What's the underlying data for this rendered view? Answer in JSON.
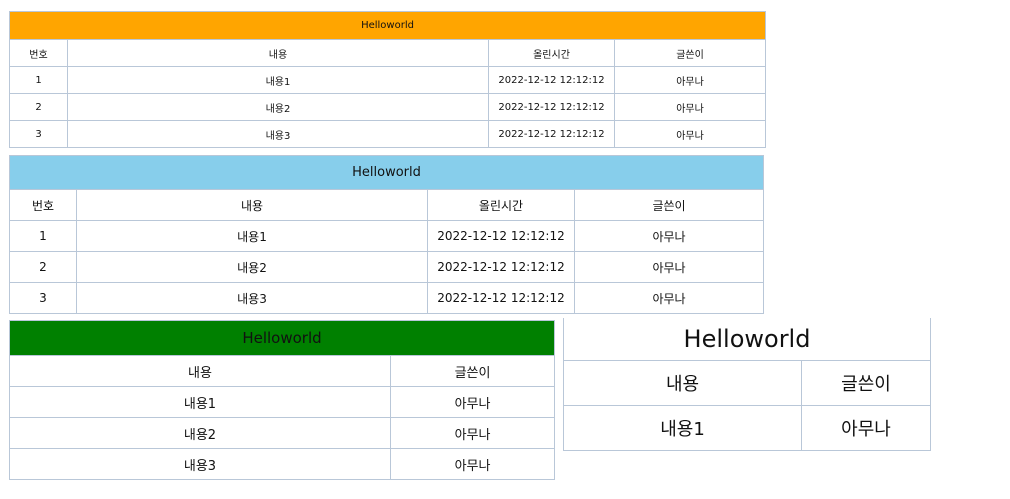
{
  "tables": [
    {
      "title": "Helloworld",
      "title_bg": "#FFA500",
      "headers": [
        "번호",
        "내용",
        "올린시간",
        "글쓴이"
      ],
      "rows": [
        [
          "1",
          "내용1",
          "2022-12-12 12:12:12",
          "아무나"
        ],
        [
          "2",
          "내용2",
          "2022-12-12 12:12:12",
          "아무나"
        ],
        [
          "3",
          "내용3",
          "2022-12-12 12:12:12",
          "아무나"
        ]
      ]
    },
    {
      "title": "Helloworld",
      "title_bg": "#87CEEB",
      "headers": [
        "번호",
        "내용",
        "올린시간",
        "글쓴이"
      ],
      "rows": [
        [
          "1",
          "내용1",
          "2022-12-12 12:12:12",
          "아무나"
        ],
        [
          "2",
          "내용2",
          "2022-12-12 12:12:12",
          "아무나"
        ],
        [
          "3",
          "내용3",
          "2022-12-12 12:12:12",
          "아무나"
        ]
      ]
    },
    {
      "title": "Helloworld",
      "title_bg": "#008000",
      "headers": [
        "내용",
        "글쓴이"
      ],
      "rows": [
        [
          "내용1",
          "아무나"
        ],
        [
          "내용2",
          "아무나"
        ],
        [
          "내용3",
          "아무나"
        ]
      ]
    },
    {
      "title": "Helloworld",
      "title_bg": "#FFFFFF",
      "headers": [
        "내용",
        "글쓴이"
      ],
      "rows": [
        [
          "내용1",
          "아무나"
        ]
      ]
    }
  ]
}
